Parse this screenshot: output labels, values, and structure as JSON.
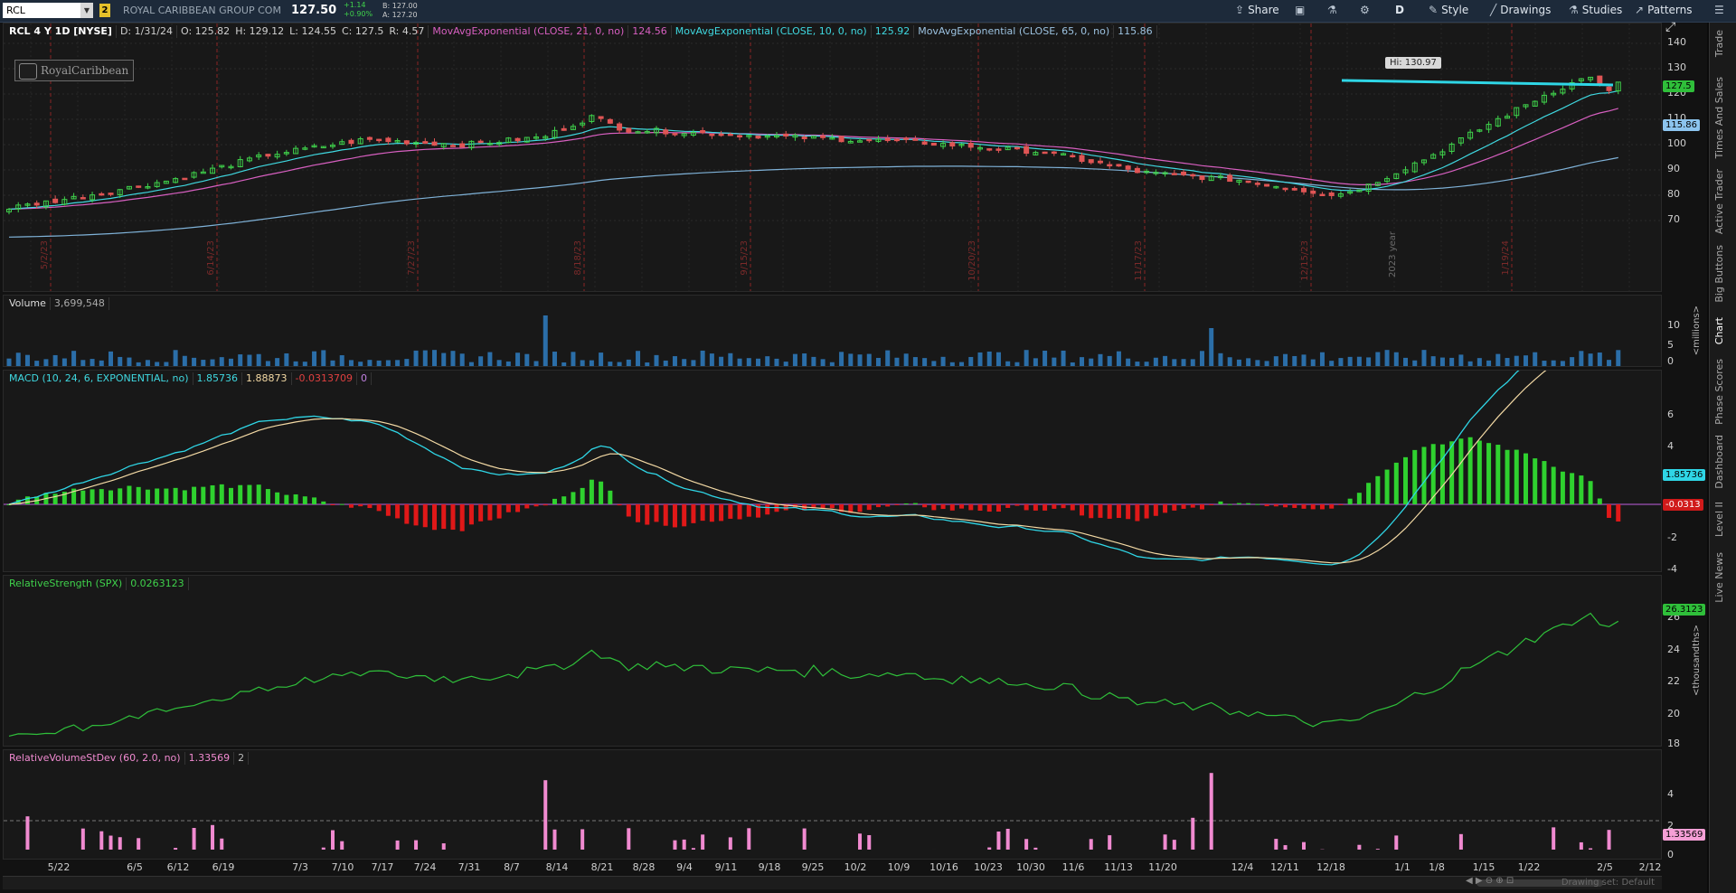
{
  "toolbar": {
    "symbol": "RCL",
    "link_badge": "2",
    "company": "ROYAL CARIBBEAN GROUP COM",
    "last": "127.50",
    "change": "+1.14",
    "change_pct": "+0.90%",
    "bid": "B: 127.00",
    "ask": "A: 127.20",
    "share": "Share",
    "aggregation": "D",
    "style": "Style",
    "drawings": "Drawings",
    "studies": "Studies",
    "patterns": "Patterns"
  },
  "right_tabs": [
    "Trade",
    "Times And Sales",
    "Active Trader",
    "Big Buttons",
    "Chart",
    "Phase Scores",
    "Dashboard",
    "Level II",
    "Live News"
  ],
  "price_pane": {
    "title": "RCL 4 Y 1D [NYSE]",
    "date": "D: 1/31/24",
    "open": "O: 125.82",
    "high": "H: 129.12",
    "low": "L: 124.55",
    "close": "C: 127.5",
    "range": "R: 4.57",
    "ema21_label": "MovAvgExponential (CLOSE, 21, 0, no)",
    "ema21_value": "124.56",
    "ema10_label": "MovAvgExponential (CLOSE, 10, 0, no)",
    "ema10_value": "125.92",
    "ema65_label": "MovAvgExponential (CLOSE, 65, 0, no)",
    "ema65_value": "115.86",
    "logo_text": "RoyalCaribbean",
    "hi_tag": "Hi: 130.97",
    "year_marker": "2023 year",
    "ticks": [
      "140",
      "130",
      "120",
      "110",
      "100",
      "90",
      "80",
      "70"
    ],
    "last_badge": "127.5",
    "ema65_badge": "115.86",
    "colors": {
      "ema10": "#3fd8e0",
      "ema21": "#d75fc0",
      "ema65": "#7fb2d8",
      "up": "#3fd24b",
      "down": "#e05555",
      "trend": "#2fd6e6"
    },
    "earnings_labels": [
      "5/2/23",
      "6/14/23",
      "7/27/23",
      "8/18/23",
      "9/15/23",
      "10/20/23",
      "11/17/23",
      "12/15/23",
      "1/19/24"
    ]
  },
  "volume_pane": {
    "label": "Volume",
    "value": "3,699,548",
    "ticks": [
      "10",
      "5",
      "0"
    ],
    "unit": "<millions>"
  },
  "macd_pane": {
    "label": "MACD (10, 24, 6, EXPONENTIAL, no)",
    "value": "1.85736",
    "avg": "1.88873",
    "diff": "-0.0313709",
    "zero": "0",
    "ticks": [
      "6",
      "4",
      "2",
      "0",
      "-2",
      "-4"
    ],
    "value_badge": "1.85736",
    "diff_badge": "-0.0313"
  },
  "rs_pane": {
    "label": "RelativeStrength (SPX)",
    "value": "0.0263123",
    "ticks": [
      "26",
      "24",
      "22",
      "20",
      "18"
    ],
    "badge": "26.3123",
    "unit": "<thousandths>"
  },
  "rvol_pane": {
    "label": "RelativeVolumeStDev (60, 2.0, no)",
    "value": "1.33569",
    "threshold": "2",
    "ticks": [
      "4",
      "2",
      "0"
    ],
    "badge": "1.33569"
  },
  "x_axis": [
    "5/22",
    "6/5",
    "6/12",
    "6/19",
    "7/3",
    "7/10",
    "7/17",
    "7/24",
    "7/31",
    "8/7",
    "8/14",
    "8/21",
    "8/28",
    "9/4",
    "9/11",
    "9/18",
    "9/25",
    "10/2",
    "10/9",
    "10/16",
    "10/23",
    "10/30",
    "11/6",
    "11/13",
    "11/20",
    "12/4",
    "12/11",
    "12/18",
    "1/1",
    "1/8",
    "1/15",
    "1/22",
    "2/5",
    "2/12"
  ],
  "drawing_set": "Drawing set: Default"
}
